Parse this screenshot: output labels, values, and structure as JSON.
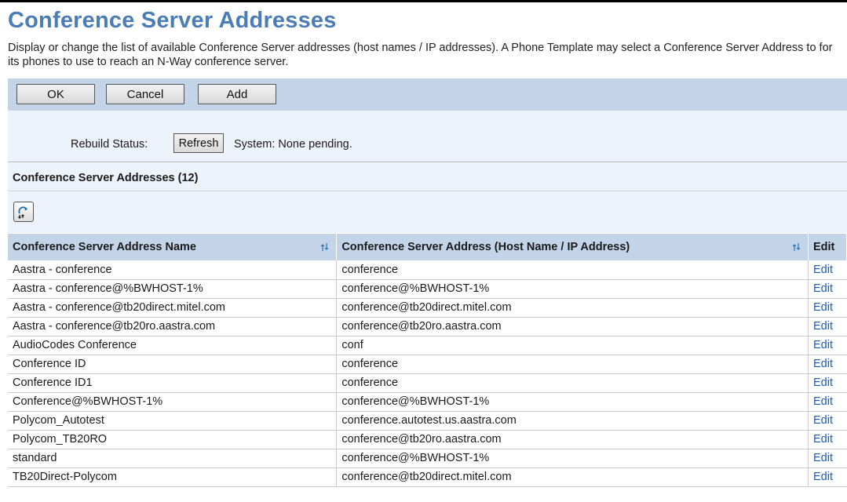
{
  "page": {
    "title": "Conference Server Addresses",
    "description": "Display or change the list of available Conference Server addresses (host names / IP addresses). A Phone Template may select a Conference Server Address to for its phones to use to reach an N-Way conference server."
  },
  "toolbar": {
    "ok_label": "OK",
    "cancel_label": "Cancel",
    "add_label": "Add"
  },
  "rebuild": {
    "label": "Rebuild Status:",
    "refresh_label": "Refresh",
    "status": "System: None pending."
  },
  "section": {
    "title": "Conference Server Addresses (12)"
  },
  "table": {
    "headers": {
      "name": "Conference Server Address Name",
      "address": "Conference Server Address (Host Name / IP Address)",
      "edit": "Edit"
    },
    "rows": [
      {
        "name": "Aastra - conference",
        "address": "conference",
        "edit": "Edit"
      },
      {
        "name": "Aastra - conference@%BWHOST-1%",
        "address": "conference@%BWHOST-1%",
        "edit": "Edit"
      },
      {
        "name": "Aastra - conference@tb20direct.mitel.com",
        "address": "conference@tb20direct.mitel.com",
        "edit": "Edit"
      },
      {
        "name": "Aastra - conference@tb20ro.aastra.com",
        "address": "conference@tb20ro.aastra.com",
        "edit": "Edit"
      },
      {
        "name": "AudioCodes Conference",
        "address": "conf",
        "edit": "Edit"
      },
      {
        "name": "Conference ID",
        "address": "conference",
        "edit": "Edit"
      },
      {
        "name": "Conference ID1",
        "address": "conference",
        "edit": "Edit"
      },
      {
        "name": "Conference@%BWHOST-1%",
        "address": "conference@%BWHOST-1%",
        "edit": "Edit"
      },
      {
        "name": "Polycom_Autotest",
        "address": "conference.autotest.us.aastra.com",
        "edit": "Edit"
      },
      {
        "name": "Polycom_TB20RO",
        "address": "conference@tb20ro.aastra.com",
        "edit": "Edit"
      },
      {
        "name": "standard",
        "address": "conference@%BWHOST-1%",
        "edit": "Edit"
      },
      {
        "name": "TB20Direct-Polycom",
        "address": "conference@tb20direct.mitel.com",
        "edit": "Edit"
      }
    ]
  },
  "colors": {
    "title": "#4a7db5",
    "toolbar_bg": "#c3d4e9",
    "panel_bg": "#edf3fb",
    "link": "#1a5fb4"
  }
}
